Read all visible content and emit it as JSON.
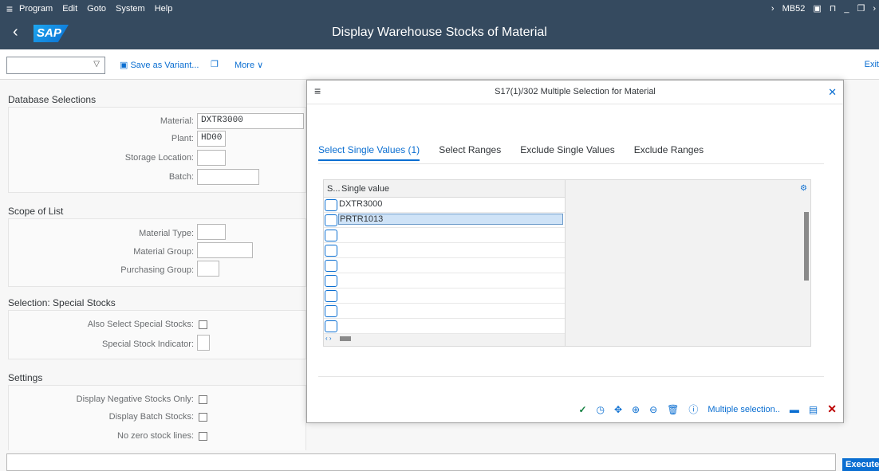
{
  "menu": {
    "items": [
      "Program",
      "Edit",
      "Goto",
      "System",
      "Help"
    ],
    "transaction": "MB52"
  },
  "title": "Display Warehouse Stocks of Material",
  "toolbar": {
    "variant_value": "",
    "save_variant": "Save as Variant...",
    "more": "More",
    "exit": "Exit"
  },
  "database_selections": {
    "title": "Database Selections",
    "material_label": "Material:",
    "material_value": "DXTR3000",
    "plant_label": "Plant:",
    "plant_value": "HD00",
    "storage_label": "Storage Location:",
    "batch_label": "Batch:"
  },
  "scope": {
    "title": "Scope of List",
    "material_type_label": "Material Type:",
    "material_group_label": "Material Group:",
    "purchasing_group_label": "Purchasing Group:"
  },
  "special": {
    "title": "Selection: Special Stocks",
    "also_select_label": "Also Select Special Stocks:",
    "indicator_label": "Special Stock Indicator:"
  },
  "settings": {
    "title": "Settings",
    "negative_label": "Display Negative Stocks Only:",
    "batch_label": "Display Batch Stocks:",
    "zero_label": "No zero stock lines:"
  },
  "dialog": {
    "title": "S17(1)/302 Multiple Selection for Material",
    "tabs": [
      "Select Single Values (1)",
      "Select Ranges",
      "Exclude Single Values",
      "Exclude Ranges"
    ],
    "grid": {
      "col1": "S...",
      "col2": "Single value",
      "rows": [
        "DXTR3000",
        "PRTR1013",
        "",
        "",
        "",
        "",
        "",
        "",
        ""
      ]
    },
    "multiple_selection": "Multiple selection.."
  },
  "execute": "Execute"
}
